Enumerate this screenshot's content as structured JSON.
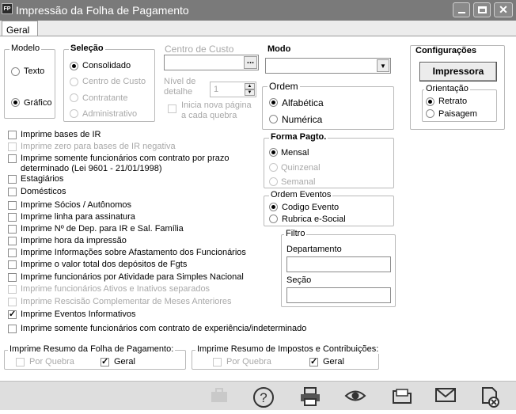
{
  "window": {
    "title": "Impressão da Folha de Pagamento",
    "icon_label": "FP",
    "controls": [
      "minimize-icon",
      "restore-icon",
      "close-icon"
    ]
  },
  "tabs": [
    {
      "label": "Geral",
      "active": true
    }
  ],
  "modelo": {
    "title": "Modelo",
    "options": [
      {
        "label": "Texto",
        "selected": false
      },
      {
        "label": "Gráfico",
        "selected": true
      }
    ]
  },
  "selecao": {
    "title": "Seleção",
    "options": [
      {
        "label": "Consolidado",
        "selected": true,
        "enabled": true
      },
      {
        "label": "Centro de Custo",
        "selected": false,
        "enabled": false
      },
      {
        "label": "Contratante",
        "selected": false,
        "enabled": false
      },
      {
        "label": "Administrativo",
        "selected": false,
        "enabled": false
      }
    ]
  },
  "centro_custo": {
    "label": "Centro de Custo",
    "value": "",
    "browse_label": "...",
    "nivel_label_1": "Nível de",
    "nivel_label_2": "detalhe",
    "nivel_value": "1",
    "inicia_label_1": "Inicia nova página",
    "inicia_label_2": "a cada quebra"
  },
  "modo": {
    "title": "Modo",
    "value": ""
  },
  "ordem": {
    "title": "Ordem",
    "options": [
      {
        "label": "Alfabética",
        "selected": true
      },
      {
        "label": "Numérica",
        "selected": false
      }
    ]
  },
  "forma_pagto": {
    "title": "Forma Pagto.",
    "options": [
      {
        "label": "Mensal",
        "selected": true,
        "enabled": true
      },
      {
        "label": "Quinzenal",
        "selected": false,
        "enabled": false
      },
      {
        "label": "Semanal",
        "selected": false,
        "enabled": false
      }
    ]
  },
  "ordem_eventos": {
    "title": "Ordem Eventos",
    "options": [
      {
        "label": "Codigo Evento",
        "selected": true
      },
      {
        "label": "Rubrica e-Social",
        "selected": false
      }
    ]
  },
  "configuracoes": {
    "title": "Configurações",
    "printer_button": "Impressora",
    "orientacao_title": "Orientação",
    "orientacao_options": [
      {
        "label": "Retrato",
        "selected": true
      },
      {
        "label": "Paisagem",
        "selected": false
      }
    ]
  },
  "filtro": {
    "title": "Filtro",
    "departamento_label": "Departamento",
    "departamento_value": "",
    "secao_label": "Seção",
    "secao_value": ""
  },
  "checkboxes": [
    {
      "label": "Imprime bases de IR",
      "checked": false,
      "enabled": true
    },
    {
      "label": "Imprime zero para bases de IR negativa",
      "checked": false,
      "enabled": false
    },
    {
      "label": "Imprime somente funcionários com contrato por prazo",
      "label2": "determinado (Lei 9601 - 21/01/1998)",
      "checked": false,
      "enabled": true
    },
    {
      "label": "Estagiários",
      "checked": false,
      "enabled": true
    },
    {
      "label": "Domésticos",
      "checked": false,
      "enabled": true
    },
    {
      "label": "Imprime Sócios / Autônomos",
      "checked": false,
      "enabled": true
    },
    {
      "label": "Imprime linha para assinatura",
      "checked": false,
      "enabled": true
    },
    {
      "label": "Imprime Nº de Dep. para IR e Sal. Família",
      "checked": false,
      "enabled": true
    },
    {
      "label": "Imprime hora da impressão",
      "checked": false,
      "enabled": true
    },
    {
      "label": "Imprime Informações sobre Afastamento dos Funcionários",
      "checked": false,
      "enabled": true
    },
    {
      "label": "Imprime o valor total dos depósitos de Fgts",
      "checked": false,
      "enabled": true
    },
    {
      "label": "Imprime funcionários por Atividade para Simples Nacional",
      "checked": false,
      "enabled": true
    },
    {
      "label": "Imprime funcionários Ativos e Inativos separados",
      "checked": false,
      "enabled": false
    },
    {
      "label": "Imprime Rescisão Complementar de Meses Anteriores",
      "checked": false,
      "enabled": false
    },
    {
      "label": "Imprime Eventos Informativos",
      "checked": true,
      "enabled": true
    },
    {
      "label": "Imprime somente funcionários com contrato de experiência/indeterminado",
      "checked": false,
      "enabled": true
    }
  ],
  "resumo_folha": {
    "title": "Imprime Resumo da Folha de Pagamento:",
    "por_quebra": {
      "label": "Por Quebra",
      "checked": false,
      "enabled": false
    },
    "geral": {
      "label": "Geral",
      "checked": true,
      "enabled": true
    }
  },
  "resumo_impostos": {
    "title": "Imprime Resumo de Impostos e Contribuições:",
    "por_quebra": {
      "label": "Por Quebra",
      "checked": false,
      "enabled": false
    },
    "geral": {
      "label": "Geral",
      "checked": true,
      "enabled": true
    }
  },
  "toolbar_icons": [
    "briefcase-icon",
    "help-icon",
    "printer-icon",
    "preview-eye-icon",
    "open-folder-icon",
    "email-icon",
    "clear-document-icon"
  ]
}
